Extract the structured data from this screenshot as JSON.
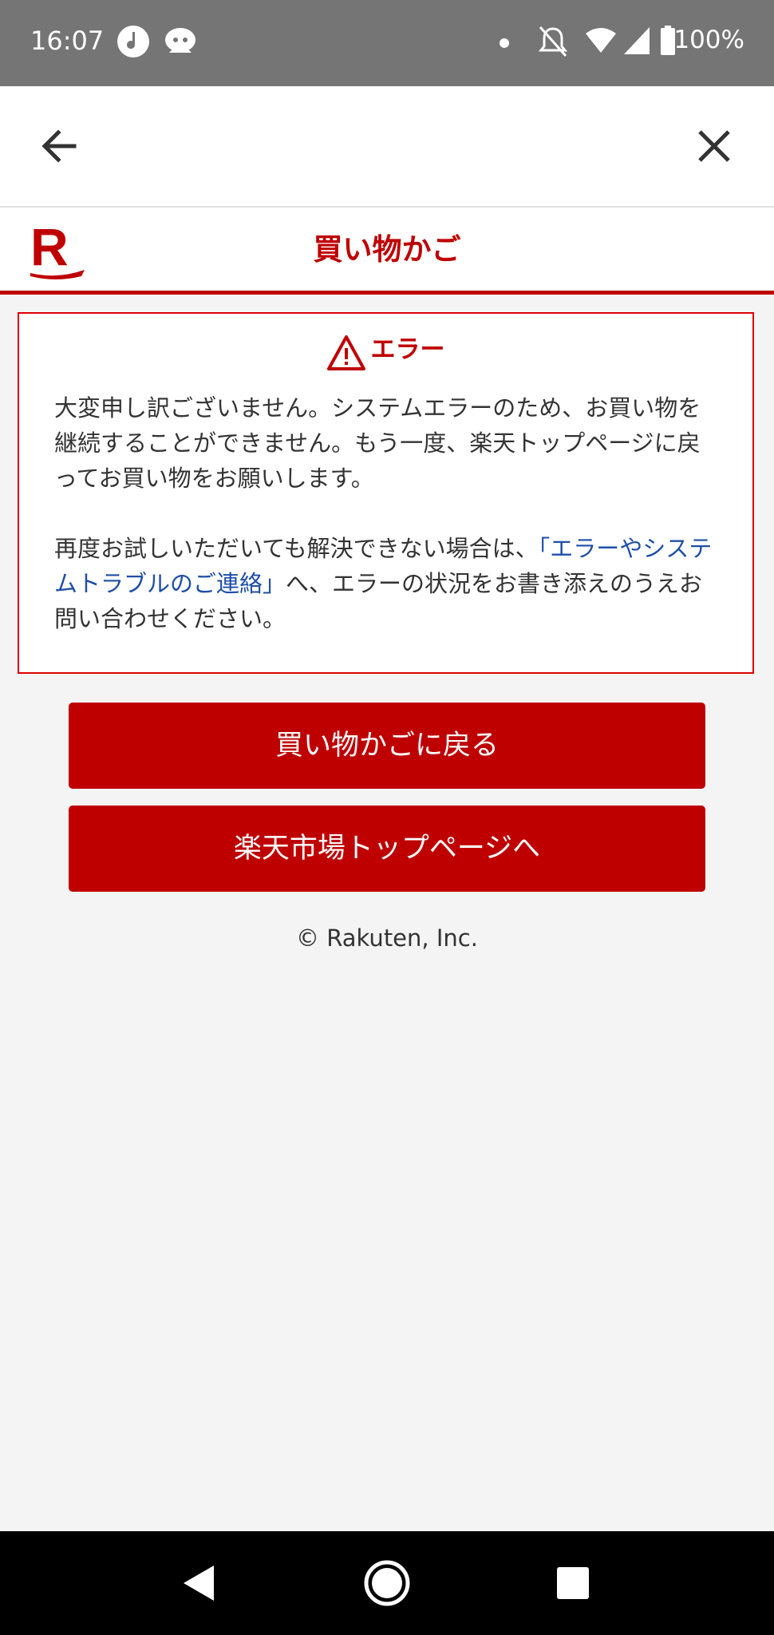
{
  "status_bar": {
    "time": "16:07",
    "battery": "100%",
    "icons": [
      "music-icon",
      "chat-bot-icon",
      "dot-icon",
      "mute-icon",
      "wifi-icon",
      "signal-icon",
      "battery-icon"
    ]
  },
  "toolbar": {
    "back_icon": "arrow-left-icon",
    "close_icon": "close-icon"
  },
  "header": {
    "logo": "R",
    "title": "買い物かご"
  },
  "error": {
    "heading": "エラー",
    "message1": "大変申し訳ございません。システムエラーのため、お買い物を継続することができません。もう一度、楽天トップページに戻ってお買い物をお願いします。",
    "message2_before": "再度お試しいただいても解決できない場合は、",
    "message2_link": "「エラーやシステムトラブルのご連絡」",
    "message2_after": "へ、エラーの状況をお書き添えのうえお問い合わせください。"
  },
  "buttons": {
    "back_to_cart": "買い物かごに戻る",
    "to_top": "楽天市場トップページへ"
  },
  "footer": {
    "copyright": "© Rakuten, Inc."
  },
  "colors": {
    "brand": "#bf0000",
    "link": "#1f4fa8",
    "background": "#f4f4f4"
  }
}
